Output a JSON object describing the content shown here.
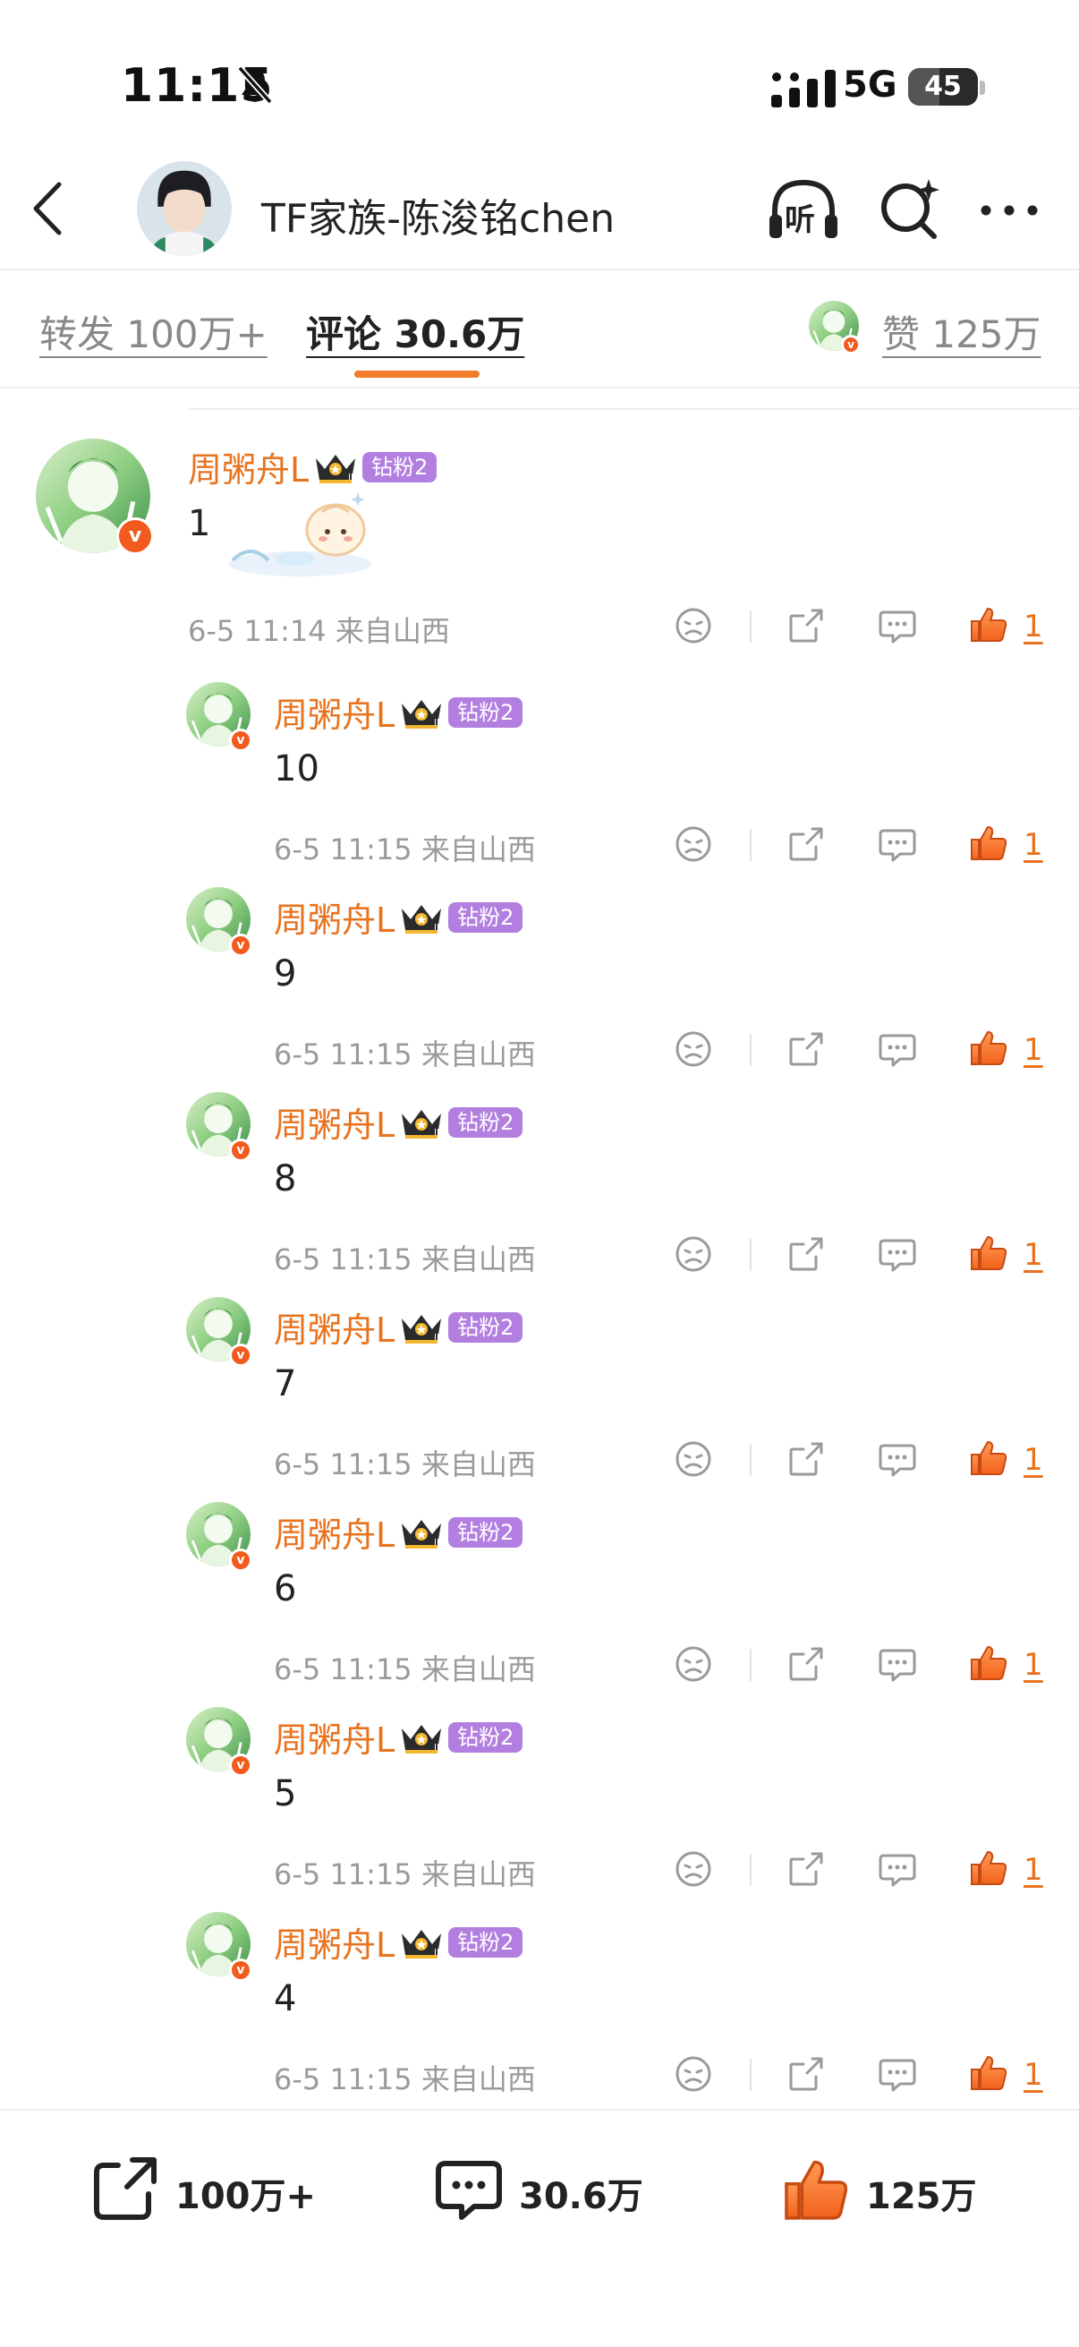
{
  "status_bar": {
    "time": "11:15",
    "network": "5G",
    "battery": "45",
    "battery_level": 0.45
  },
  "nav": {
    "title": "TF家族-陈浚铭chen",
    "listen_label": "听"
  },
  "tabs": {
    "repost": "转发 100万+",
    "comments": "评论 30.6万",
    "likes": "赞 125万"
  },
  "main_comment": {
    "username": "周粥舟L",
    "badge": "钻粉2",
    "text": "1",
    "meta": "6-5 11:14  来自山西",
    "likes": "1"
  },
  "replies": [
    {
      "username": "周粥舟L",
      "badge": "钻粉2",
      "text": "10",
      "meta": "6-5 11:15  来自山西",
      "likes": "1"
    },
    {
      "username": "周粥舟L",
      "badge": "钻粉2",
      "text": "9",
      "meta": "6-5 11:15  来自山西",
      "likes": "1"
    },
    {
      "username": "周粥舟L",
      "badge": "钻粉2",
      "text": "8",
      "meta": "6-5 11:15  来自山西",
      "likes": "1"
    },
    {
      "username": "周粥舟L",
      "badge": "钻粉2",
      "text": "7",
      "meta": "6-5 11:15  来自山西",
      "likes": "1"
    },
    {
      "username": "周粥舟L",
      "badge": "钻粉2",
      "text": "6",
      "meta": "6-5 11:15  来自山西",
      "likes": "1"
    },
    {
      "username": "周粥舟L",
      "badge": "钻粉2",
      "text": "5",
      "meta": "6-5 11:15  来自山西",
      "likes": "1"
    },
    {
      "username": "周粥舟L",
      "badge": "钻粉2",
      "text": "4",
      "meta": "6-5 11:15  来自山西",
      "likes": "1"
    }
  ],
  "bottom_bar": {
    "repost": "100万+",
    "comment": "30.6万",
    "like": "125万"
  },
  "colors": {
    "accent": "#e8731f",
    "tab_indicator": "#f07c2c",
    "fan_badge": "#b27fe0",
    "verified": "#f25a1e"
  }
}
